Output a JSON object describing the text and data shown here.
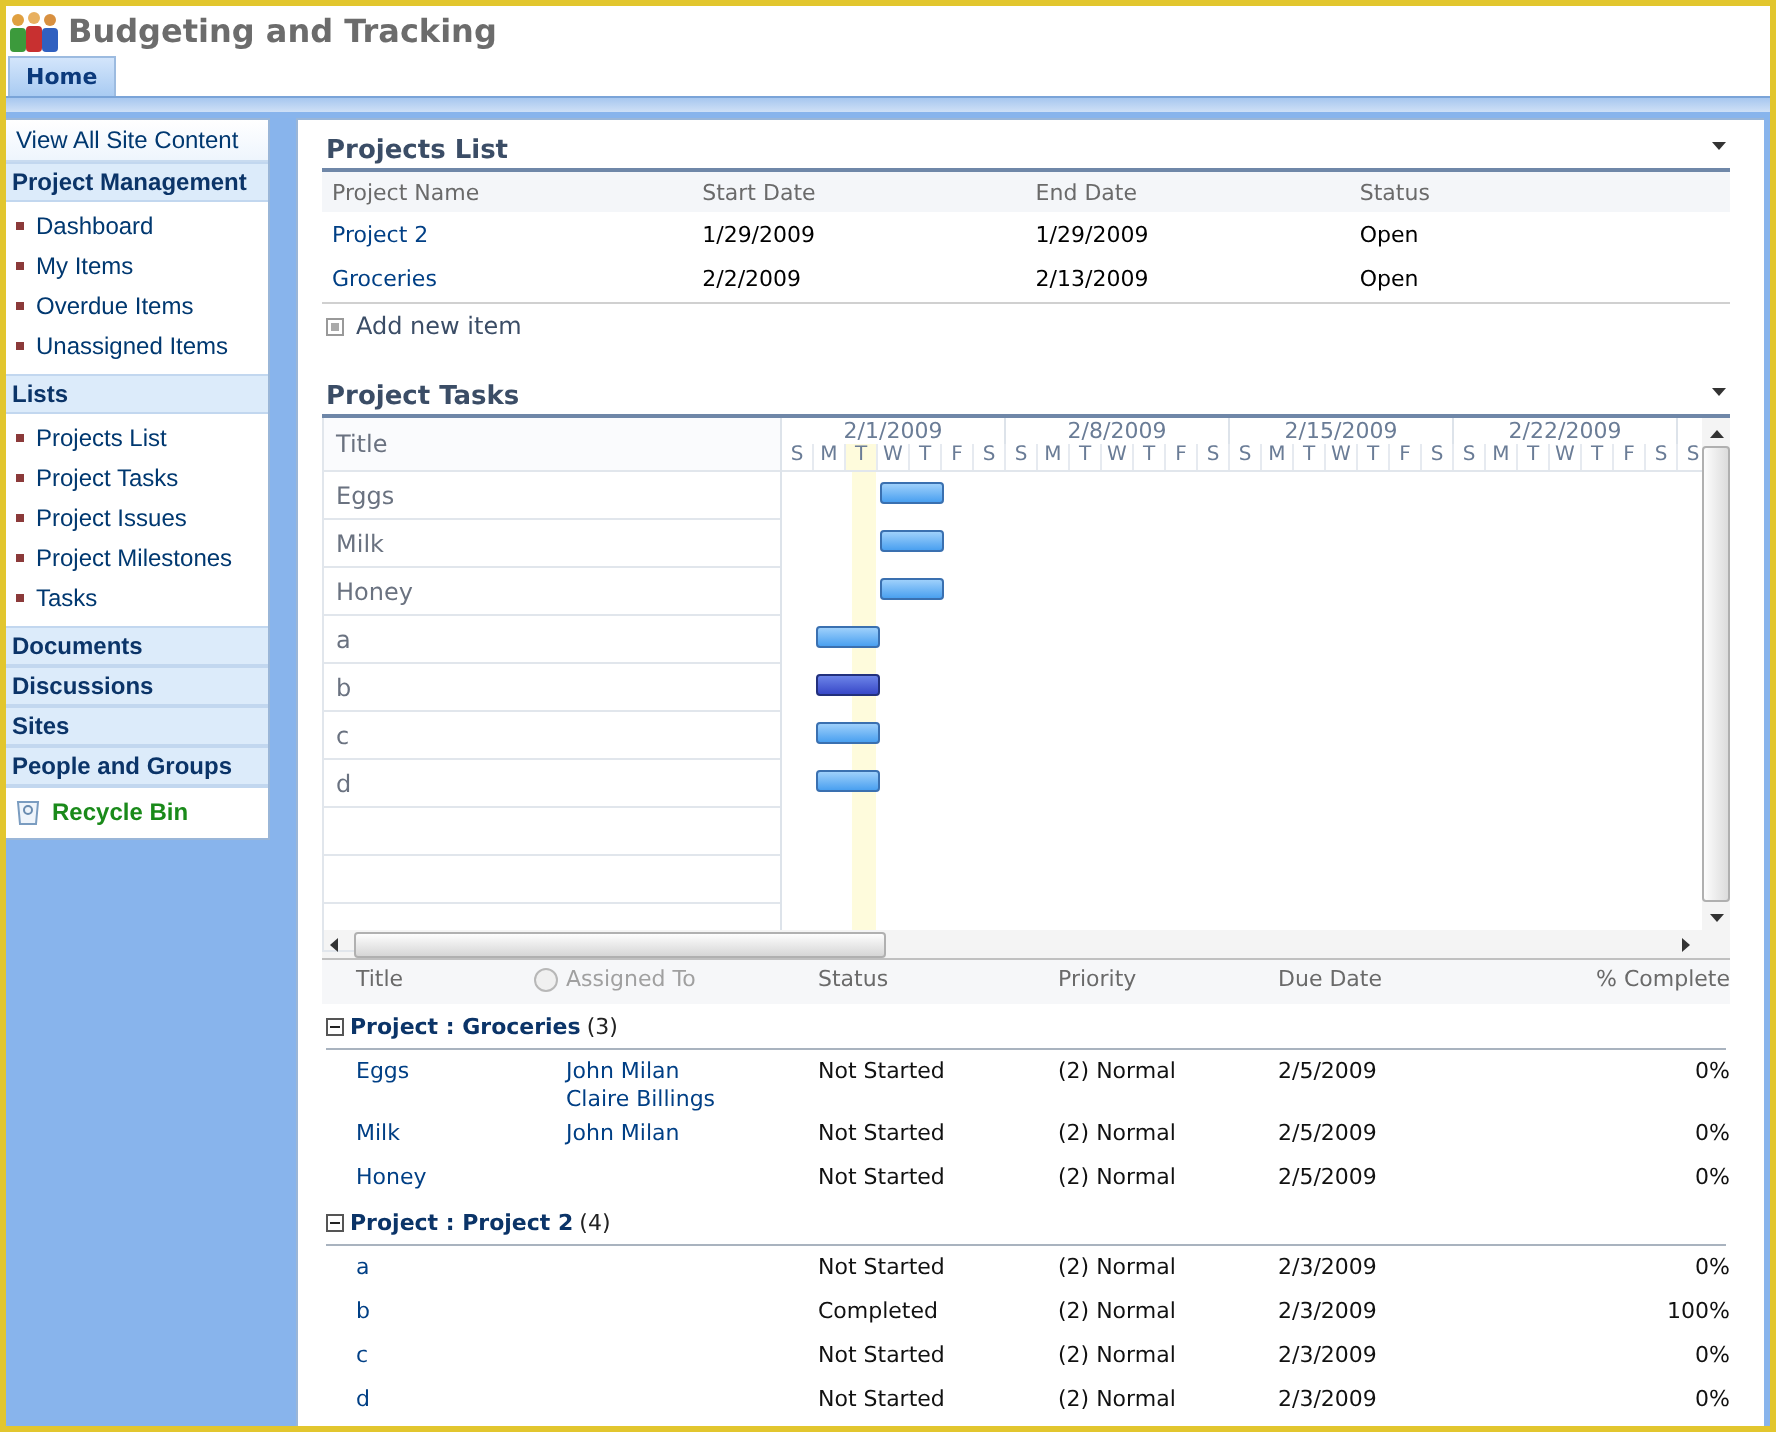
{
  "site": {
    "title": "Budgeting and Tracking"
  },
  "tabs": [
    {
      "label": "Home",
      "selected": true
    }
  ],
  "quick_launch": {
    "view_all": "View All Site Content",
    "sections": [
      {
        "heading": "Project Management",
        "items": [
          "Dashboard",
          "My Items",
          "Overdue Items",
          "Unassigned Items"
        ]
      },
      {
        "heading": "Lists",
        "items": [
          "Projects List",
          "Project Tasks",
          "Project Issues",
          "Project Milestones",
          "Tasks"
        ]
      },
      {
        "heading": "Documents"
      },
      {
        "heading": "Discussions"
      },
      {
        "heading": "Sites"
      },
      {
        "heading": "People and Groups"
      }
    ],
    "recycle_bin": "Recycle Bin"
  },
  "projects_list": {
    "title": "Projects List",
    "columns": [
      "Project Name",
      "Start Date",
      "End Date",
      "Status"
    ],
    "rows": [
      [
        "Project 2",
        "1/29/2009",
        "1/29/2009",
        "Open"
      ],
      [
        "Groceries",
        "2/2/2009",
        "2/13/2009",
        "Open"
      ]
    ],
    "add_new": "Add new item"
  },
  "project_tasks": {
    "title": "Project Tasks",
    "gantt": {
      "title_header": "Title",
      "week_labels": [
        "2/1/2009",
        "2/8/2009",
        "2/15/2009",
        "2/22/2009"
      ],
      "days": [
        {
          "label": "S",
          "today": false
        },
        {
          "label": "M",
          "today": false
        },
        {
          "label": "T",
          "today": true
        },
        {
          "label": "W",
          "today": false
        },
        {
          "label": "T",
          "today": false
        },
        {
          "label": "F",
          "today": false
        },
        {
          "label": "S",
          "today": false
        },
        {
          "label": "S",
          "today": false
        },
        {
          "label": "M",
          "today": false
        },
        {
          "label": "T",
          "today": false
        },
        {
          "label": "W",
          "today": false
        },
        {
          "label": "T",
          "today": false
        },
        {
          "label": "F",
          "today": false
        },
        {
          "label": "S",
          "today": false
        },
        {
          "label": "S",
          "today": false
        },
        {
          "label": "M",
          "today": false
        },
        {
          "label": "T",
          "today": false
        },
        {
          "label": "W",
          "today": false
        },
        {
          "label": "T",
          "today": false
        },
        {
          "label": "F",
          "today": false
        },
        {
          "label": "S",
          "today": false
        },
        {
          "label": "S",
          "today": false
        },
        {
          "label": "M",
          "today": false
        },
        {
          "label": "T",
          "today": false
        },
        {
          "label": "W",
          "today": false
        },
        {
          "label": "T",
          "today": false
        },
        {
          "label": "F",
          "today": false
        },
        {
          "label": "S",
          "today": false
        },
        {
          "label": "S",
          "today": false
        }
      ],
      "rows": [
        {
          "title": "Eggs",
          "selected": false
        },
        {
          "title": "Milk",
          "selected": false
        },
        {
          "title": "Honey",
          "selected": false
        },
        {
          "title": "a",
          "selected": false
        },
        {
          "title": "b",
          "selected": true
        },
        {
          "title": "c",
          "selected": false
        },
        {
          "title": "d",
          "selected": false
        }
      ]
    },
    "task_list": {
      "columns": [
        "Title",
        "Assigned To",
        "Status",
        "Priority",
        "Due Date",
        "% Complete"
      ],
      "groups": [
        {
          "label": "Project : Groceries",
          "count": "(3)",
          "expanded": true,
          "rows": [
            {
              "title": "Eggs",
              "assigned_to": [
                "John Milan",
                "Claire Billings"
              ],
              "status": "Not Started",
              "priority": "(2) Normal",
              "due": "2/5/2009",
              "complete": "0%"
            },
            {
              "title": "Milk",
              "assigned_to": [
                "John Milan"
              ],
              "status": "Not Started",
              "priority": "(2) Normal",
              "due": "2/5/2009",
              "complete": "0%"
            },
            {
              "title": "Honey",
              "status": "Not Started",
              "priority": "(2) Normal",
              "due": "2/5/2009",
              "complete": "0%"
            }
          ]
        },
        {
          "label": "Project : Project 2",
          "count": "(4)",
          "expanded": true,
          "rows": [
            {
              "title": "a",
              "status": "Not Started",
              "priority": "(2) Normal",
              "due": "2/3/2009",
              "complete": "0%"
            },
            {
              "title": "b",
              "status": "Completed",
              "priority": "(2) Normal",
              "due": "2/3/2009",
              "complete": "100%"
            },
            {
              "title": "c",
              "status": "Not Started",
              "priority": "(2) Normal",
              "due": "2/3/2009",
              "complete": "0%"
            },
            {
              "title": "d",
              "status": "Not Started",
              "priority": "(2) Normal",
              "due": "2/3/2009",
              "complete": "0%"
            }
          ]
        }
      ]
    }
  }
}
